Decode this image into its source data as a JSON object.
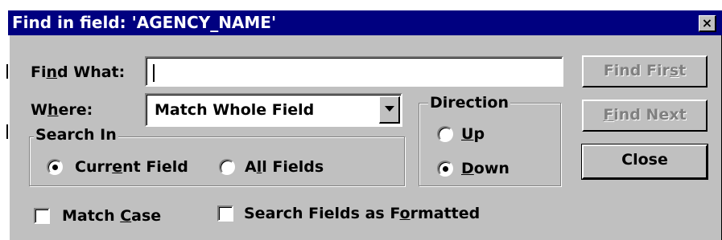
{
  "window": {
    "title": "Find in field: 'AGENCY_NAME'",
    "close_glyph": "×",
    "title_bar_color": "#000080",
    "face_color": "#c0c0c0"
  },
  "find_what": {
    "label_pre": "Fi",
    "label_key": "n",
    "label_post": "d What:",
    "value": ""
  },
  "where": {
    "label_pre": "W",
    "label_key": "h",
    "label_post": "ere:",
    "selected": "Match Whole Field",
    "arrow_icon": "dropdown-arrow-icon"
  },
  "search_in": {
    "label": "Search In",
    "options": [
      {
        "pre": "Current ",
        "key": "",
        "post": "",
        "text_pre": "Curr",
        "text_key": "e",
        "text_post": "nt Field",
        "selected": true
      },
      {
        "text_pre": "A",
        "text_key": "l",
        "text_post": "l Fields",
        "selected": false
      }
    ]
  },
  "direction": {
    "label": "Direction",
    "options": [
      {
        "text_pre": "",
        "text_key": "U",
        "text_post": "p",
        "selected": false
      },
      {
        "text_pre": "",
        "text_key": "D",
        "text_post": "own",
        "selected": true
      }
    ]
  },
  "buttons": {
    "find_first": {
      "pre": "Find Fir",
      "key": "s",
      "post": "t",
      "enabled": false
    },
    "find_next": {
      "pre": "",
      "key": "F",
      "post": "ind Next",
      "enabled": false
    },
    "close": {
      "label": "Close",
      "enabled": true
    }
  },
  "checkboxes": {
    "match_case": {
      "pre": "Match ",
      "key": "C",
      "post": "ase",
      "checked": false
    },
    "search_formatted": {
      "pre": "Search Fields as F",
      "key": "o",
      "post": "rmatted",
      "checked": false
    }
  }
}
